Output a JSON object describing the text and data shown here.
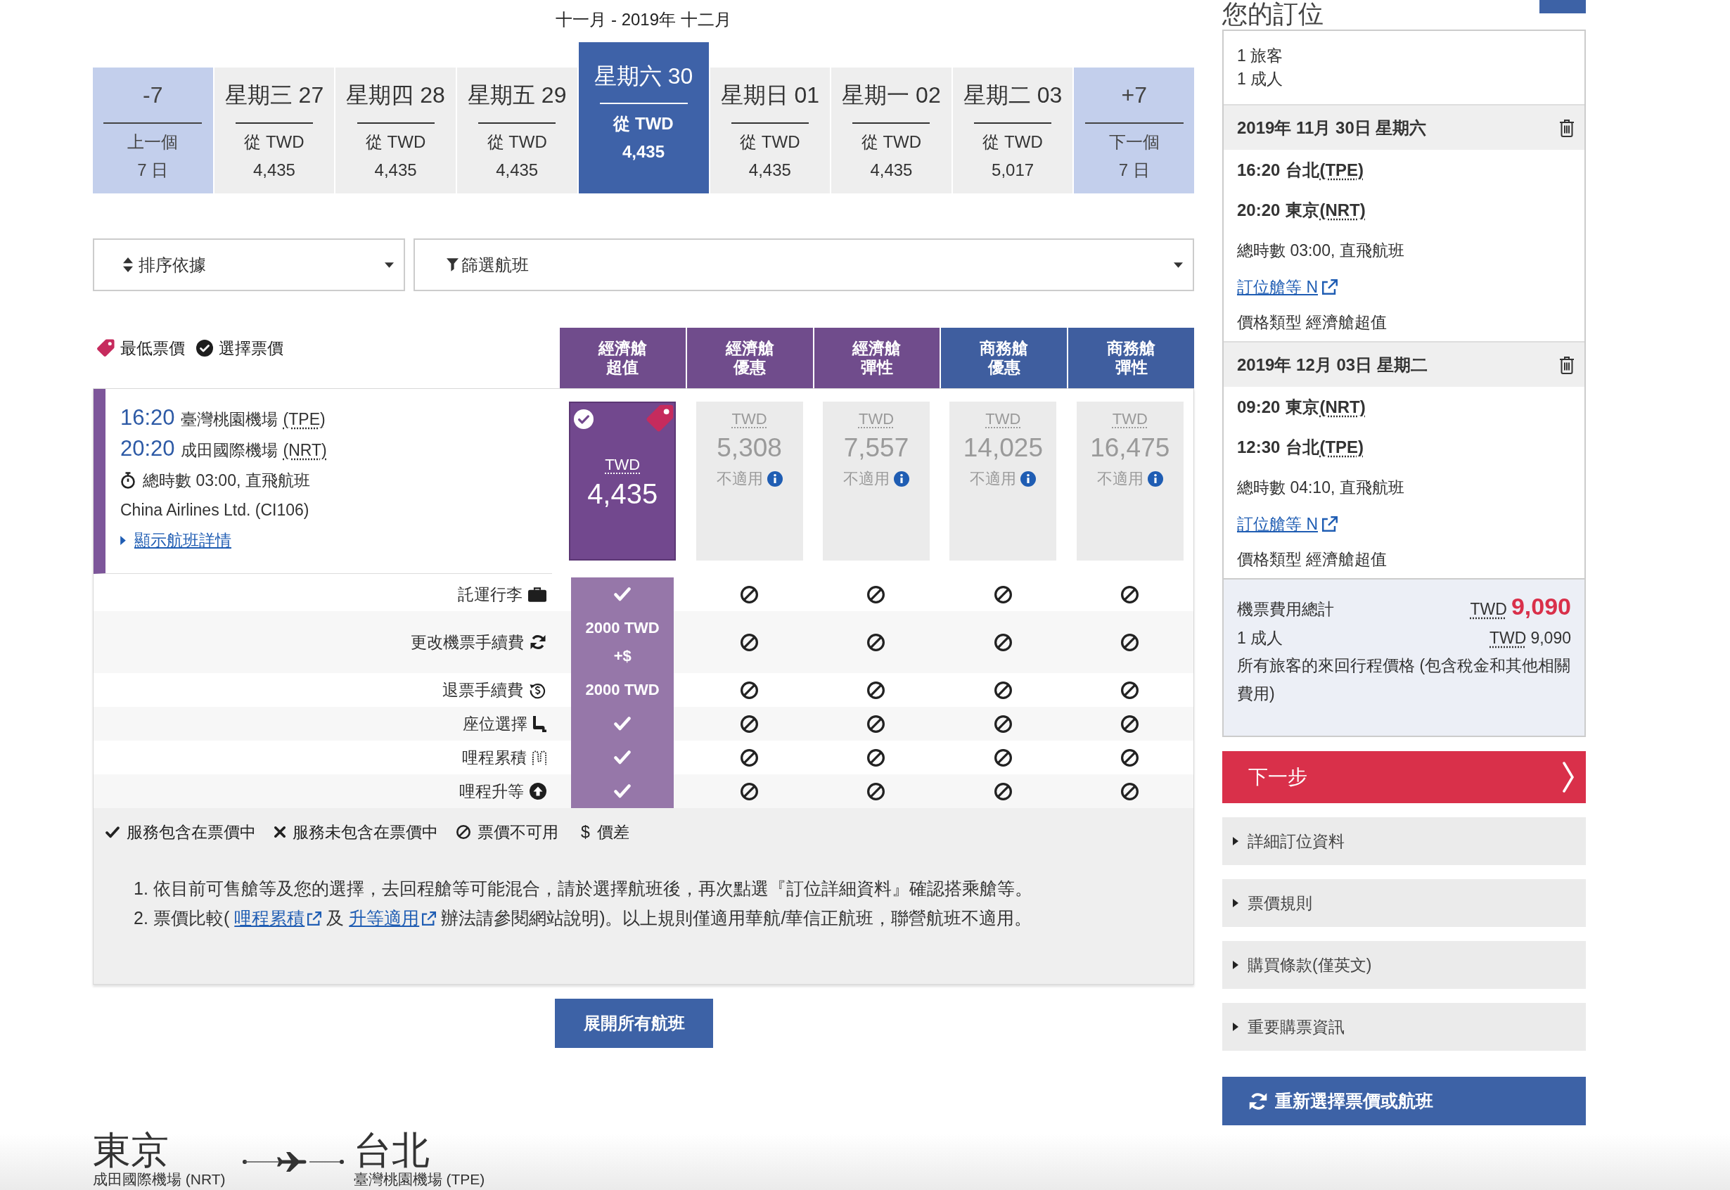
{
  "date_strip": {
    "title": "十一月 - 2019年 十二月",
    "items": [
      {
        "kind": "nav",
        "label": "-7",
        "caption": "上一個",
        "sub": "7 日",
        "selected": false
      },
      {
        "kind": "date",
        "label": "星期三 27",
        "caption": "從 TWD",
        "sub": "4,435",
        "selected": false
      },
      {
        "kind": "date",
        "label": "星期四 28",
        "caption": "從 TWD",
        "sub": "4,435",
        "selected": false
      },
      {
        "kind": "date",
        "label": "星期五 29",
        "caption": "從 TWD",
        "sub": "4,435",
        "selected": false
      },
      {
        "kind": "date",
        "label": "星期六 30",
        "caption": "從 TWD",
        "sub": "4,435",
        "selected": true
      },
      {
        "kind": "date",
        "label": "星期日 01",
        "caption": "從 TWD",
        "sub": "4,435",
        "selected": false
      },
      {
        "kind": "date",
        "label": "星期一 02",
        "caption": "從 TWD",
        "sub": "4,435",
        "selected": false
      },
      {
        "kind": "date",
        "label": "星期二 03",
        "caption": "從 TWD",
        "sub": "5,017",
        "selected": false
      },
      {
        "kind": "nav",
        "label": "+7",
        "caption": "下一個",
        "sub": "7 日",
        "selected": false
      }
    ]
  },
  "sort": {
    "label": "排序依據"
  },
  "filter": {
    "label": "篩選航班"
  },
  "fare_legend": [
    {
      "kind": "lowest",
      "label": "最低票價"
    },
    {
      "kind": "selected",
      "label": "選擇票價"
    }
  ],
  "fare_columns": [
    {
      "label": "經濟艙超值",
      "color": "#704c8c"
    },
    {
      "label": "經濟艙優惠",
      "color": "#704c8c"
    },
    {
      "label": "經濟艙彈性",
      "color": "#704c8c"
    },
    {
      "label": "商務艙優惠",
      "color": "#3f5e9f"
    },
    {
      "label": "商務艙彈性",
      "color": "#3f5e9f"
    }
  ],
  "flight": {
    "depart_time": "16:20",
    "depart_airport": "臺灣桃園機場",
    "depart_code": "(TPE)",
    "arrive_time": "20:20",
    "arrive_airport": "成田國際機場",
    "arrive_code": "(NRT)",
    "duration": "總時數 03:00, 直飛航班",
    "carrier": "China Airlines Ltd. (CI106)",
    "details_link": "顯示航班詳情",
    "fares": [
      {
        "currency": "TWD",
        "price": "4,435",
        "selected": true,
        "lowest": true
      },
      {
        "currency": "TWD",
        "price": "5,308",
        "note": "不適用",
        "selected": false,
        "lowest": false
      },
      {
        "currency": "TWD",
        "price": "7,557",
        "note": "不適用",
        "selected": false,
        "lowest": false
      },
      {
        "currency": "TWD",
        "price": "14,025",
        "note": "不適用",
        "selected": false,
        "lowest": false
      },
      {
        "currency": "TWD",
        "price": "16,475",
        "note": "不適用",
        "selected": false,
        "lowest": false
      }
    ]
  },
  "services": [
    {
      "label": "託運行李",
      "cells": [
        {
          "kind": "included"
        },
        {
          "kind": "unavailable"
        },
        {
          "kind": "unavailable"
        },
        {
          "kind": "unavailable"
        },
        {
          "kind": "unavailable"
        }
      ]
    },
    {
      "label": "更改機票手續費",
      "cells": [
        {
          "kind": "fee",
          "text": "2000 TWD\n+$"
        },
        {
          "kind": "unavailable"
        },
        {
          "kind": "unavailable"
        },
        {
          "kind": "unavailable"
        },
        {
          "kind": "unavailable"
        }
      ]
    },
    {
      "label": "退票手續費",
      "cells": [
        {
          "kind": "fee",
          "text": "2000 TWD"
        },
        {
          "kind": "unavailable"
        },
        {
          "kind": "unavailable"
        },
        {
          "kind": "unavailable"
        },
        {
          "kind": "unavailable"
        }
      ]
    },
    {
      "label": "座位選擇",
      "cells": [
        {
          "kind": "included"
        },
        {
          "kind": "unavailable"
        },
        {
          "kind": "unavailable"
        },
        {
          "kind": "unavailable"
        },
        {
          "kind": "unavailable"
        }
      ]
    },
    {
      "label": "哩程累積",
      "cells": [
        {
          "kind": "included"
        },
        {
          "kind": "unavailable"
        },
        {
          "kind": "unavailable"
        },
        {
          "kind": "unavailable"
        },
        {
          "kind": "unavailable"
        }
      ]
    },
    {
      "label": "哩程升等",
      "cells": [
        {
          "kind": "included"
        },
        {
          "kind": "unavailable"
        },
        {
          "kind": "unavailable"
        },
        {
          "kind": "unavailable"
        },
        {
          "kind": "unavailable"
        }
      ]
    }
  ],
  "symbol_legend": [
    {
      "kind": "included",
      "label": "服務包含在票價中"
    },
    {
      "kind": "excluded",
      "label": "服務未包含在票價中"
    },
    {
      "kind": "unavailable",
      "label": "票價不可用"
    },
    {
      "kind": "price-diff",
      "symbol": "$",
      "label": "價差"
    }
  ],
  "notes": [
    {
      "number": "1.",
      "parts": [
        {
          "kind": "text",
          "text": "依目前可售艙等及您的選擇，去回程艙等可能混合，請於選擇航班後，再次點選『訂位詳細資料』確認搭乘艙等。"
        }
      ]
    },
    {
      "number": "2.",
      "parts": [
        {
          "kind": "text",
          "text": "票價比較( "
        },
        {
          "kind": "link",
          "text": "哩程累積"
        },
        {
          "kind": "text",
          "text": " 及 "
        },
        {
          "kind": "link",
          "text": "升等適用"
        },
        {
          "kind": "text",
          "text": " 辦法請參閱網站說明)。以上規則僅適用華航/華信正航班，聯營航班不適用。"
        }
      ]
    }
  ],
  "expand_button": "展開所有航班",
  "route": {
    "from_city": "東京",
    "from_airport": "成田國際機場 (NRT)",
    "to_city": "台北",
    "to_airport": "臺灣桃園機場 (TPE)"
  },
  "summary": {
    "title": "您的訂位",
    "passengers": [
      "1 旅客",
      "1 成人"
    ],
    "segments": [
      {
        "date": "2019年 11月 30日 星期六",
        "stops": [
          {
            "time": "16:20",
            "place": "台北",
            "code": "(TPE)"
          },
          {
            "time": "20:20",
            "place": "東京",
            "code": "(NRT)"
          }
        ],
        "duration": "總時數 03:00, 直飛航班",
        "booking_class": "訂位艙等 N",
        "fare_type": "價格類型 經濟艙超值"
      },
      {
        "date": "2019年 12月 03日 星期二",
        "stops": [
          {
            "time": "09:20",
            "place": "東京",
            "code": "(NRT)"
          },
          {
            "time": "12:30",
            "place": "台北",
            "code": "(TPE)"
          }
        ],
        "duration": "總時數 04:10, 直飛航班",
        "booking_class": "訂位艙等 N",
        "fare_type": "價格類型 經濟艙超值"
      }
    ],
    "total": {
      "label": "機票費用總計",
      "currency": "TWD",
      "amount": "9,090",
      "rows": [
        {
          "label": "1 成人",
          "currency": "TWD",
          "amount": "9,090"
        }
      ],
      "note": "所有旅客的來回行程價格 (包含稅金和其他相關費用)"
    },
    "next_button": "下一步",
    "sections": [
      {
        "label": "詳細訂位資料",
        "expanded": false
      },
      {
        "label": "票價規則",
        "expanded": false
      },
      {
        "label": "購買條款(僅英文)",
        "expanded": false
      },
      {
        "label": "重要購票資訊",
        "expanded": false
      }
    ],
    "reselect_button": "重新選擇票價或航班"
  }
}
